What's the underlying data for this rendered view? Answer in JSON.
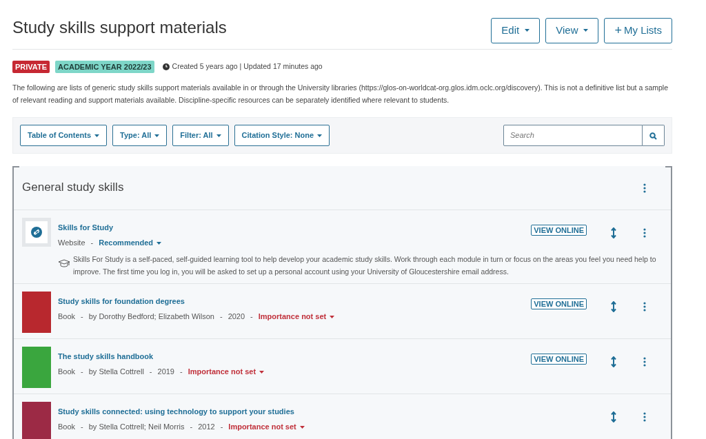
{
  "title": "Study skills support materials",
  "header_buttons": [
    {
      "label": "Edit",
      "kind": "dropdown"
    },
    {
      "label": "View",
      "kind": "dropdown"
    },
    {
      "label": "My Lists",
      "kind": "add",
      "icon": "+"
    }
  ],
  "badges": [
    {
      "label": "PRIVATE",
      "color": "#c62833"
    },
    {
      "label": "ACADEMIC YEAR 2022/23",
      "color": "#7ed6c8"
    }
  ],
  "dates": "Created 5 years ago | Updated 17 minutes ago",
  "description": "The following are lists of generic study skills support materials available in or through the University libraries (https://glos-on-worldcat-org.glos.idm.oclc.org/discovery). This is not a definitive list but a sample of relevant reading and support materials available. Discipline-specific resources can be separately identified where relevant to students.",
  "filters": [
    "Table of Contents",
    "Type: All",
    "Filter: All",
    "Citation Style: None"
  ],
  "search": {
    "placeholder": "Search"
  },
  "section": {
    "title": "General study skills",
    "items": [
      {
        "kind": "website",
        "title": "Skills for Study",
        "meta": [
          "Website"
        ],
        "separators": [
          "-"
        ],
        "importance": "Recommended",
        "importance_set": true,
        "view_online": "VIEW ONLINE",
        "note": "Skills For Study is a self-paced, self-guided learning tool to help develop your academic study skills. Work through each module in turn or focus on the areas you feel you need help to improve. The first time you log in, you will be asked to set up a personal account using your University of Gloucestershire email address."
      },
      {
        "kind": "book",
        "title": "Study skills for foundation degrees",
        "meta": [
          "Book",
          "by Dorothy Bedford; Elizabeth Wilson",
          "2020"
        ],
        "separators": [
          "-",
          "-",
          "-"
        ],
        "importance": "Importance not set",
        "importance_set": false,
        "view_online": "VIEW ONLINE",
        "color": "#b8282e"
      },
      {
        "kind": "book",
        "title": "The study skills handbook",
        "meta": [
          "Book",
          "by Stella Cottrell",
          "2019"
        ],
        "separators": [
          "-",
          "-",
          "-"
        ],
        "importance": "Importance not set",
        "importance_set": false,
        "view_online": "VIEW ONLINE",
        "color": "#3aa63e"
      },
      {
        "kind": "book",
        "title": "Study skills connected: using technology to support your studies",
        "meta": [
          "Book",
          "by Stella Cottrell; Neil Morris",
          "2012"
        ],
        "separators": [
          "-",
          "-",
          "-"
        ],
        "importance": "Importance not set",
        "importance_set": false,
        "color": "#9c2a45"
      }
    ]
  }
}
